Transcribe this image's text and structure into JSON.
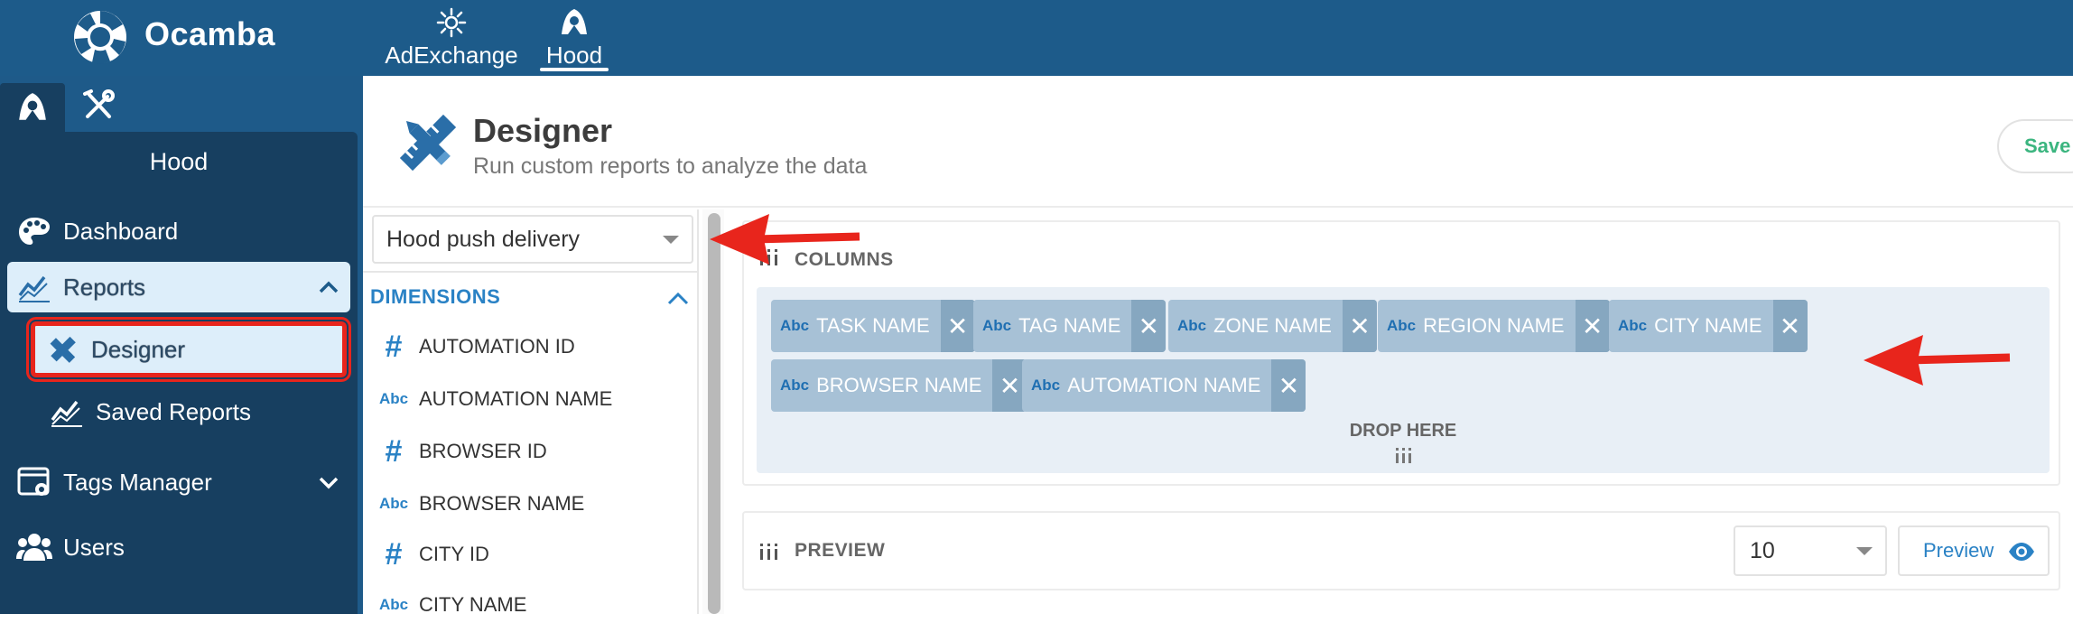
{
  "topbar": {
    "brand": "Ocamba",
    "nav": [
      {
        "label": "AdExchange",
        "icon": "sun-icon"
      },
      {
        "label": "Hood",
        "icon": "hood-icon",
        "active": true
      }
    ]
  },
  "sidebar": {
    "panel_title": "Hood",
    "items": [
      {
        "label": "Dashboard",
        "icon": "palette-icon"
      },
      {
        "label": "Reports",
        "icon": "chart-icon",
        "expanded": true
      },
      {
        "label": "Designer",
        "icon": "pencil-ruler-icon",
        "active": true
      },
      {
        "label": "Saved Reports",
        "icon": "chart-icon"
      },
      {
        "label": "Tags Manager",
        "icon": "tag-window-icon"
      },
      {
        "label": "Users",
        "icon": "users-icon"
      }
    ]
  },
  "header": {
    "title": "Designer",
    "subtitle": "Run custom reports to analyze the data",
    "save_label": "Save"
  },
  "dimensions": {
    "source_value": "Hood push delivery",
    "header": "DIMENSIONS",
    "items": [
      {
        "type": "#",
        "label": "AUTOMATION ID"
      },
      {
        "type": "Abc",
        "label": "AUTOMATION NAME"
      },
      {
        "type": "#",
        "label": "BROWSER ID"
      },
      {
        "type": "Abc",
        "label": "BROWSER NAME"
      },
      {
        "type": "#",
        "label": "CITY ID"
      },
      {
        "type": "Abc",
        "label": "CITY NAME"
      }
    ]
  },
  "columns": {
    "title": "COLUMNS",
    "type_label": "Abc",
    "remove_glyph": "✕",
    "chips": [
      "TASK NAME",
      "TAG NAME",
      "ZONE NAME",
      "REGION NAME",
      "CITY NAME",
      "BROWSER NAME",
      "AUTOMATION NAME"
    ],
    "drop_text": "DROP HERE"
  },
  "preview": {
    "title": "PREVIEW",
    "rows_value": "10",
    "button_label": "Preview"
  },
  "colors": {
    "topbar": "#1d5b8a",
    "sidebar_panel": "#173f60",
    "accent_blue": "#2a82c5",
    "chip": "#a7c1d6",
    "annotation_red": "#e8251c",
    "save_green": "#3bb57f"
  }
}
